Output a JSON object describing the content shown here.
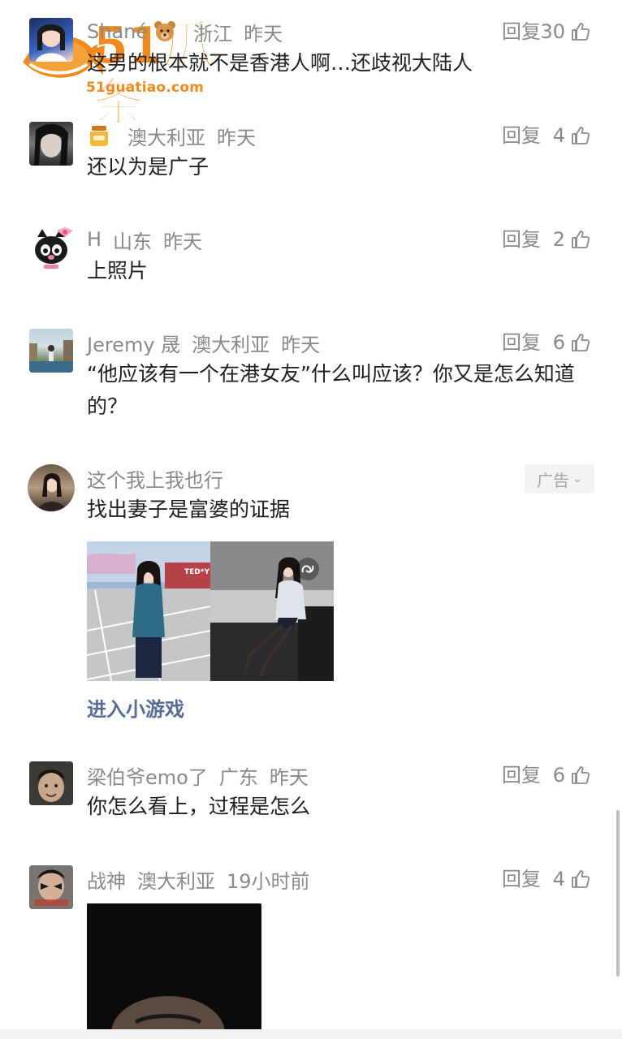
{
  "watermark": {
    "logo_text": "51瓜条",
    "site": "51guatiao.com"
  },
  "reply_label": "回复",
  "comments": [
    {
      "name": "Shané",
      "name_emoji": "bear-emoji",
      "region": "浙江",
      "time": "昨天",
      "likes": "30",
      "text": "这男的根本就不是香港人啊…还歧视大陆人"
    },
    {
      "name": "",
      "name_emoji": "honey-jar-emoji",
      "region": "澳大利亚",
      "time": "昨天",
      "likes": "4",
      "text": "还以为是广子"
    },
    {
      "name": "H",
      "region": "山东",
      "time": "昨天",
      "likes": "2",
      "text": "上照片"
    },
    {
      "name": "Jeremy 晟",
      "region": "澳大利亚",
      "time": "昨天",
      "likes": "6",
      "text": "“他应该有一个在港女友”什么叫应该？你又是怎么知道的？"
    },
    {
      "name": "梁伯爷emo了",
      "region": "广东",
      "time": "昨天",
      "likes": "6",
      "text": "你怎么看上，过程是怎么"
    },
    {
      "name": "战神",
      "region": "澳大利亚",
      "time": "19小时前",
      "likes": "4",
      "text": ""
    }
  ],
  "ad": {
    "name": "这个我上我也行",
    "badge": "广告",
    "text": "找出妻子是富婆的证据",
    "image_sign": "TED*Y",
    "link": "进入小游戏"
  },
  "colors": {
    "meta": "#8a8a8a",
    "link": "#576b95",
    "watermark": "#f08a1c"
  }
}
